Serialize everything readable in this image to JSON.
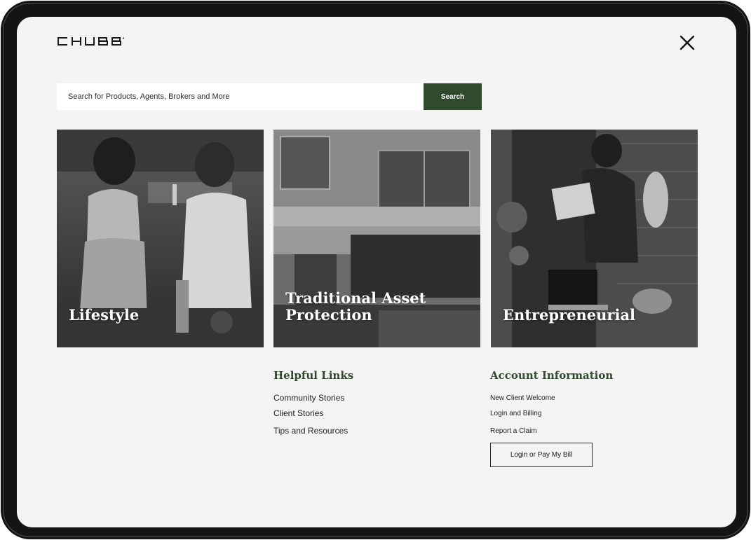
{
  "brand": {
    "logo_text": "CHUBB"
  },
  "search": {
    "placeholder": "Search for Products, Agents, Brokers and More",
    "button_label": "Search"
  },
  "cards": [
    {
      "label": "Lifestyle"
    },
    {
      "label": "Traditional Asset\nProtection"
    },
    {
      "label": "Entrepreneurial"
    }
  ],
  "helpful_links": {
    "heading": "Helpful Links",
    "items": [
      "Community Stories",
      "Client Stories",
      "Tips and Resources"
    ]
  },
  "account_info": {
    "heading": "Account Information",
    "items": [
      "New Client Welcome",
      "Login and Billing",
      "Report a Claim"
    ],
    "button_label": "Login or Pay My Bill"
  },
  "colors": {
    "brand_green": "#2f4a2c",
    "screen_bg": "#f4f4f4",
    "device_frame": "#141414"
  },
  "icons": {
    "close": "close-icon"
  }
}
